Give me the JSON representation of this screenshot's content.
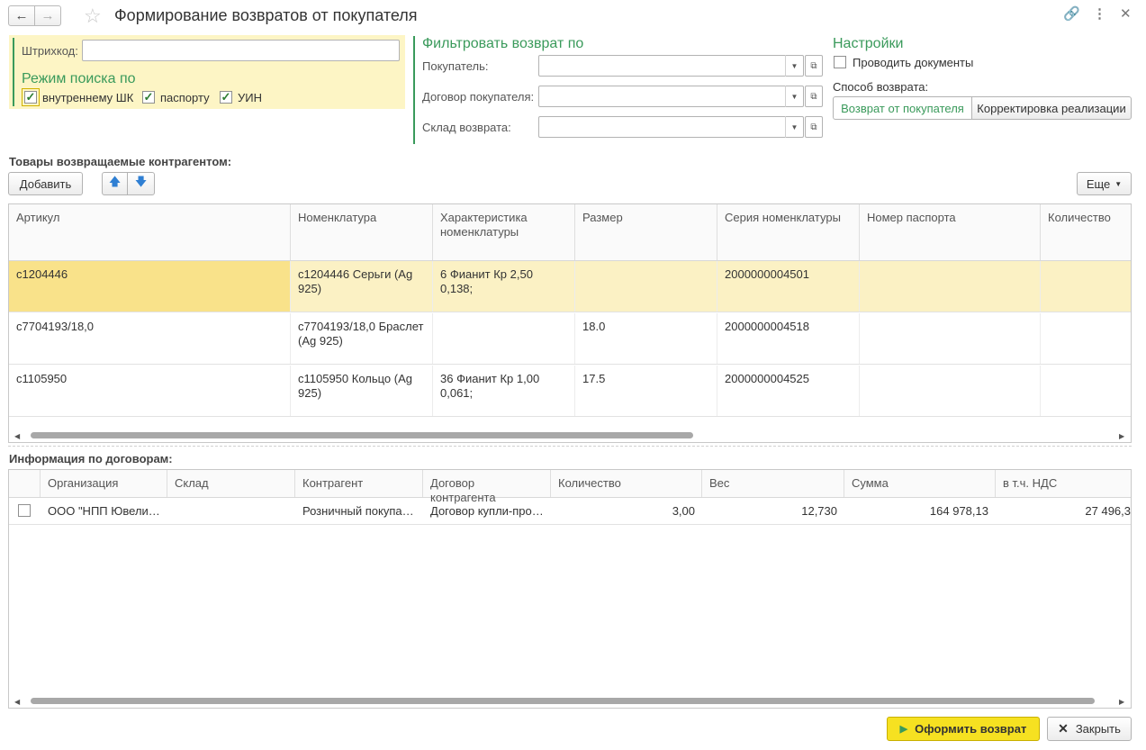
{
  "window": {
    "title": "Формирование возвратов от покупателя"
  },
  "search": {
    "barcode_label": "Штрихкод:",
    "barcode_value": "",
    "mode_title": "Режим поиска по",
    "modes": [
      {
        "label": "внутреннему ШК",
        "checked": true
      },
      {
        "label": "паспорту",
        "checked": true
      },
      {
        "label": "УИН",
        "checked": true
      }
    ]
  },
  "filter": {
    "title": "Фильтровать возврат по",
    "fields": [
      {
        "label": "Покупатель:",
        "value": ""
      },
      {
        "label": "Договор покупателя:",
        "value": ""
      },
      {
        "label": "Склад возврата:",
        "value": ""
      }
    ]
  },
  "settings": {
    "title": "Настройки",
    "post_docs_label": "Проводить документы",
    "post_docs_checked": false,
    "return_method_label": "Способ возврата:",
    "method_options": [
      "Возврат от покупателя",
      "Корректировка реализации"
    ]
  },
  "goods": {
    "title": "Товары возвращаемые контрагентом:",
    "add_label": "Добавить",
    "more_label": "Еще",
    "columns": [
      "Артикул",
      "Номенклатура",
      "Характеристика номенклатуры",
      "Размер",
      "Серия номенклатуры",
      "Номер паспорта",
      "Количество"
    ],
    "rows": [
      [
        "с1204446",
        "с1204446 Серьги (Ag 925)",
        "6 Фианит Кр 2,50 0,138;",
        "",
        "2000000004501",
        "",
        ""
      ],
      [
        "с7704193/18,0",
        "с7704193/18,0 Браслет (Ag 925)",
        "",
        "18.0",
        "2000000004518",
        "",
        ""
      ],
      [
        "с1105950",
        "с1105950 Кольцо (Ag 925)",
        "36 Фианит Кр 1,00 0,061;",
        "17.5",
        "2000000004525",
        "",
        ""
      ]
    ]
  },
  "contracts": {
    "title": "Информация по договорам:",
    "columns": [
      "Организация",
      "Склад",
      "Контрагент",
      "Договор контрагента",
      "Количество",
      "Вес",
      "Сумма",
      "в т.ч. НДС"
    ],
    "rows": [
      {
        "checked": false,
        "cells": [
          "ООО \"НПП Ювели…",
          "",
          "Розничный покупа…",
          "Договор купли-про…",
          "3,00",
          "12,730",
          "164 978,13",
          "27 496,3"
        ]
      }
    ]
  },
  "footer": {
    "submit_label": "Оформить возврат",
    "close_label": "Закрыть"
  },
  "colors": {
    "accent": "#3a9a5b",
    "selected_row": "#fbf1c4",
    "primary_button": "#f6e121"
  }
}
